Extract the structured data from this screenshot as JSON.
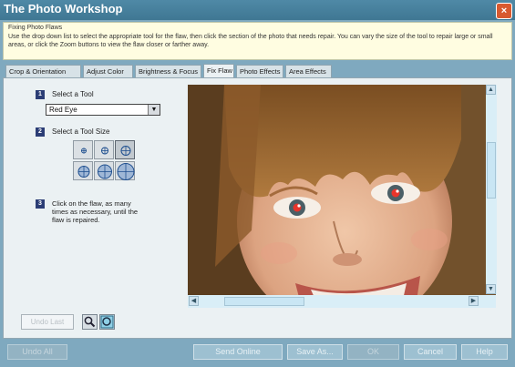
{
  "window": {
    "title": "The Photo Workshop",
    "close_label": "×"
  },
  "instructions": {
    "heading": "Fixing Photo Flaws",
    "text": "Use the drop down list to select the appropriate tool for the flaw, then click the section of the photo that needs repair. You can vary the size of the tool to repair large or small areas, or click the Zoom buttons to view the flaw closer or farther away."
  },
  "tabs": [
    {
      "label": "Crop & Orientation",
      "active": false
    },
    {
      "label": "Adjust Color",
      "active": false
    },
    {
      "label": "Brightness & Focus",
      "active": false
    },
    {
      "label": "Fix Flaw",
      "active": true
    },
    {
      "label": "Photo Effects",
      "active": false
    },
    {
      "label": "Area Effects",
      "active": false
    }
  ],
  "steps": {
    "step1": {
      "number": "1",
      "label": "Select a Tool"
    },
    "tool_select": {
      "value": "Red Eye",
      "arrow": "▼"
    },
    "step2": {
      "number": "2",
      "label": "Select a Tool Size"
    },
    "step3": {
      "number": "3",
      "text": "Click on the flaw, as many times as necessary, until the flaw is repaired."
    }
  },
  "scroll": {
    "up": "▲",
    "down": "▼",
    "left": "◀",
    "right": "▶"
  },
  "toolbar": {
    "undo_last": "Undo Last"
  },
  "footer": {
    "undo_all": "Undo All",
    "send_online": "Send Online",
    "save_as": "Save As...",
    "ok": "OK",
    "cancel": "Cancel",
    "help": "Help"
  },
  "colors": {
    "frame": "#7fa9bf",
    "titlebar": "#3f7793",
    "panel": "#ebf1f3",
    "instruction_bg": "#fffde1",
    "step_badge": "#2b3d75"
  }
}
